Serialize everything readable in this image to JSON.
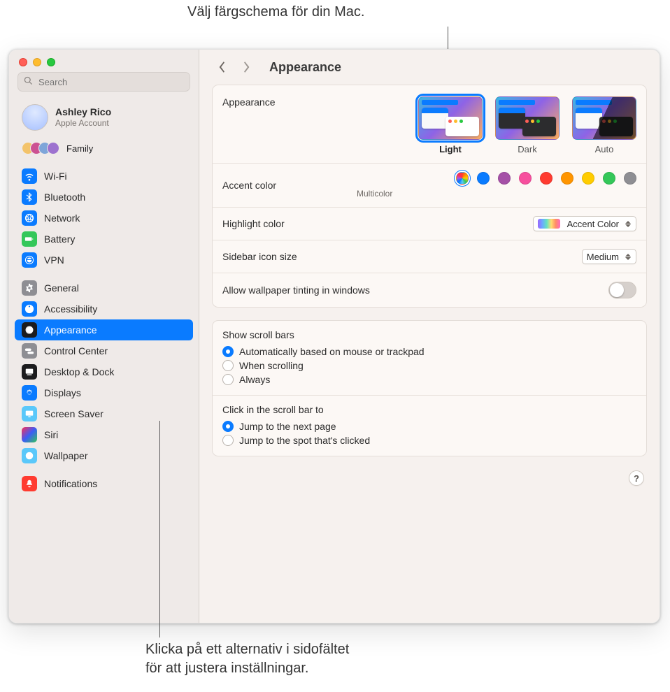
{
  "callouts": {
    "top": "Välj färgschema för din Mac.",
    "bottom_line1": "Klicka på ett alternativ i sidofältet",
    "bottom_line2": "för att justera inställningar."
  },
  "search": {
    "placeholder": "Search"
  },
  "user": {
    "name": "Ashley Rico",
    "sub": "Apple Account"
  },
  "family": {
    "label": "Family"
  },
  "sidebar": {
    "items": [
      {
        "label": "Wi-Fi"
      },
      {
        "label": "Bluetooth"
      },
      {
        "label": "Network"
      },
      {
        "label": "Battery"
      },
      {
        "label": "VPN"
      },
      {
        "label": "General"
      },
      {
        "label": "Accessibility"
      },
      {
        "label": "Appearance"
      },
      {
        "label": "Control Center"
      },
      {
        "label": "Desktop & Dock"
      },
      {
        "label": "Displays"
      },
      {
        "label": "Screen Saver"
      },
      {
        "label": "Siri"
      },
      {
        "label": "Wallpaper"
      },
      {
        "label": "Notifications"
      }
    ]
  },
  "header": {
    "title": "Appearance"
  },
  "appearance": {
    "label": "Appearance",
    "options": [
      {
        "label": "Light"
      },
      {
        "label": "Dark"
      },
      {
        "label": "Auto"
      }
    ]
  },
  "accent": {
    "label": "Accent color",
    "selected_label": "Multicolor",
    "colors": [
      "multicolor",
      "#0a7bff",
      "#a550a7",
      "#f74f9e",
      "#ff3b30",
      "#ff9500",
      "#ffcc00",
      "#34c759",
      "#8e8e93"
    ]
  },
  "highlight": {
    "label": "Highlight color",
    "value": "Accent Color"
  },
  "icon_size": {
    "label": "Sidebar icon size",
    "value": "Medium"
  },
  "tinting": {
    "label": "Allow wallpaper tinting in windows"
  },
  "scrollbars": {
    "title": "Show scroll bars",
    "options": [
      "Automatically based on mouse or trackpad",
      "When scrolling",
      "Always"
    ]
  },
  "scrollclick": {
    "title": "Click in the scroll bar to",
    "options": [
      "Jump to the next page",
      "Jump to the spot that's clicked"
    ]
  },
  "help": {
    "glyph": "?"
  }
}
